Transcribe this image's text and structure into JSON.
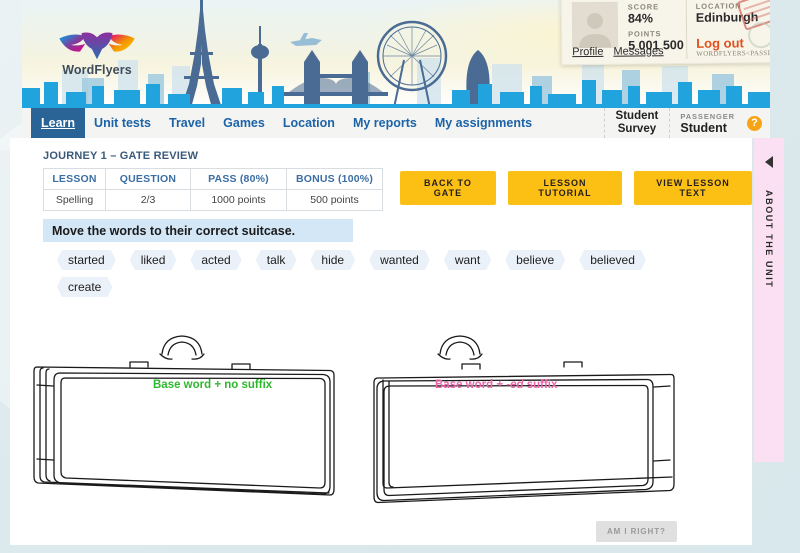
{
  "brand": {
    "name": "WordFlyers"
  },
  "passport": {
    "score_label": "SCORE",
    "score_value": "84%",
    "points_label": "POINTS",
    "points_value": "5 001 500",
    "location_label": "LOCATION",
    "location_value": "Edinburgh",
    "profile_link": "Profile",
    "messages_link": "Messages",
    "logout_link": "Log out",
    "mrz": "WORDFLYERS<PASSPORT<<<<<"
  },
  "nav": {
    "items": [
      {
        "label": "Learn",
        "active": true
      },
      {
        "label": "Unit tests",
        "active": false
      },
      {
        "label": "Travel",
        "active": false
      },
      {
        "label": "Games",
        "active": false
      },
      {
        "label": "Location",
        "active": false
      },
      {
        "label": "My reports",
        "active": false
      },
      {
        "label": "My assignments",
        "active": false
      }
    ],
    "survey_line1": "Student",
    "survey_line2": "Survey",
    "passenger_label": "PASSENGER",
    "passenger_value": "Student",
    "help_glyph": "?"
  },
  "lesson": {
    "journey": "JOURNEY 1 – GATE REVIEW",
    "table": {
      "headers": [
        "LESSON",
        "QUESTION",
        "PASS (80%)",
        "BONUS (100%)"
      ],
      "row": [
        "Spelling",
        "2/3",
        "1000 points",
        "500 points"
      ]
    },
    "buttons": [
      "BACK TO GATE",
      "LESSON TUTORIAL",
      "VIEW LESSON TEXT"
    ]
  },
  "activity": {
    "instruction": "Move the words to their correct suitcase.",
    "words": [
      "started",
      "liked",
      "acted",
      "talk",
      "hide",
      "wanted",
      "want",
      "believe",
      "believed",
      "create"
    ],
    "suitcase_left_label": "Base word + no suffix",
    "suitcase_right_label_pre": "Base word + ",
    "suitcase_right_label_em": "-ed",
    "suitcase_right_label_post": " suffix",
    "submit_label": "AM I RIGHT?"
  },
  "side_tab": {
    "label": "ABOUT THE UNIT"
  },
  "colors": {
    "accent_yellow": "#fcbf13",
    "nav_active": "#2a6496",
    "nav_link": "#1c63a8",
    "green": "#2eb82e",
    "pink": "#ee63a8",
    "logout": "#e2501e",
    "instruction_bg": "#d3e7f7",
    "side_tab_bg": "#fbe0f3"
  }
}
